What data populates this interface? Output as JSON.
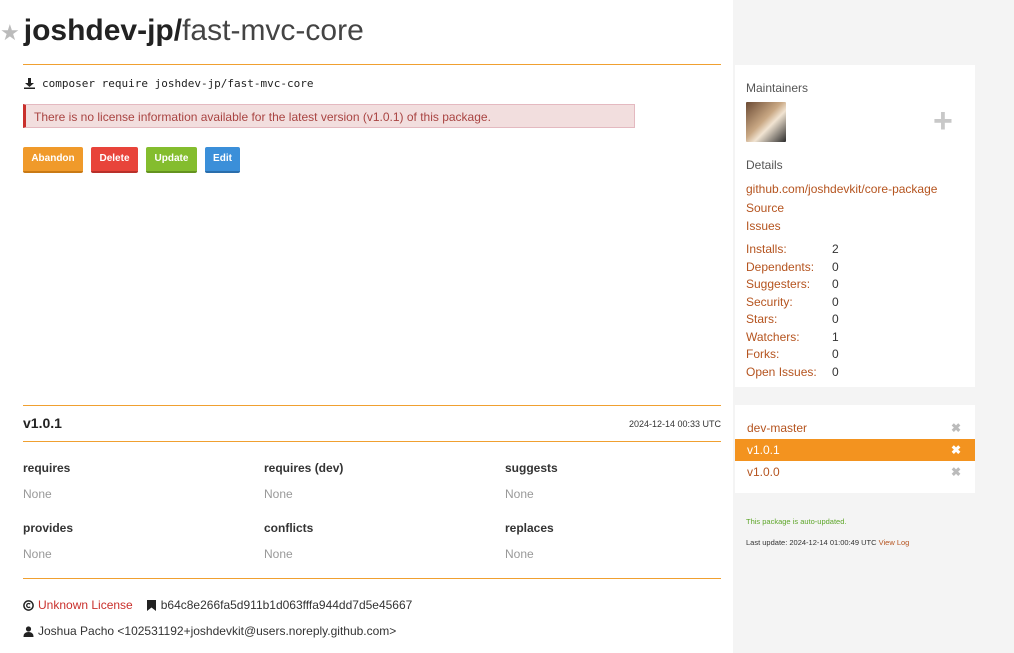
{
  "package": {
    "vendor": "joshdev-jp/",
    "name": "fast-mvc-core",
    "composer_cmd": "composer require joshdev-jp/fast-mvc-core",
    "license_alert": "There is no license information available for the latest version (v1.0.1) of this package."
  },
  "actions": {
    "abandon": "Abandon",
    "delete": "Delete",
    "update": "Update",
    "edit": "Edit"
  },
  "sidebar": {
    "maintainers_label": "Maintainers",
    "details_label": "Details",
    "links": [
      "github.com/joshdevkit/core-package",
      "Source",
      "Issues"
    ],
    "stats": [
      {
        "label": "Installs:",
        "value": "2"
      },
      {
        "label": "Dependents:",
        "value": "0"
      },
      {
        "label": "Suggesters:",
        "value": "0"
      },
      {
        "label": "Security:",
        "value": "0"
      },
      {
        "label": "Stars:",
        "value": "0"
      },
      {
        "label": "Watchers:",
        "value": "1"
      },
      {
        "label": "Forks:",
        "value": "0"
      },
      {
        "label": "Open Issues:",
        "value": "0"
      }
    ]
  },
  "versions": [
    {
      "name": "dev-master",
      "active": false
    },
    {
      "name": "v1.0.1",
      "active": true
    },
    {
      "name": "v1.0.0",
      "active": false
    }
  ],
  "update_info": {
    "auto": "This package is auto-updated.",
    "last_update": "Last update: 2024-12-14 01:00:49 UTC",
    "view_log": "View Log"
  },
  "version_detail": {
    "version": "v1.0.1",
    "date": "2024-12-14 00:33 UTC",
    "columns": [
      {
        "title": "requires",
        "value": "None"
      },
      {
        "title": "requires (dev)",
        "value": "None"
      },
      {
        "title": "suggests",
        "value": "None"
      },
      {
        "title": "provides",
        "value": "None"
      },
      {
        "title": "conflicts",
        "value": "None"
      },
      {
        "title": "replaces",
        "value": "None"
      }
    ],
    "license": "Unknown License",
    "commit": "b64c8e266fa5d911b1d063fffa944dd7d5e45667",
    "author": "Joshua Pacho <102531192+joshdevkit@users.noreply.github.com>"
  },
  "colors": {
    "accent": "#f3931f",
    "link": "#b5541f",
    "alert_text": "#a94442"
  }
}
